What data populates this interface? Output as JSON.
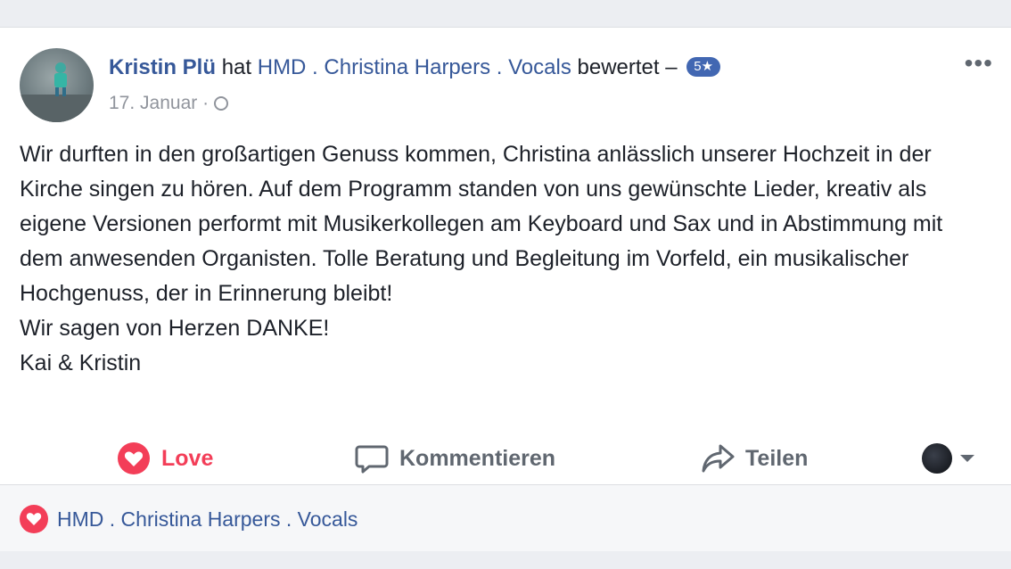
{
  "post": {
    "author": "Kristin Plü",
    "verb_has": "hat",
    "page_name": "HMD . Christina Harpers . Vocals",
    "verb_rated": "bewertet –",
    "rating_badge": "5★",
    "date": "17. Januar",
    "separator": "·",
    "paragraph_lines": [
      "Wir durften in den großartigen Genuss kommen, Christina anlässlich unserer Hochzeit in der Kirche singen zu hören. Auf dem Programm standen von uns gewünschte Lieder, kreativ als eigene Versionen performt mit Musikerkollegen am Keyboard und Sax und in Abstimmung mit dem anwesenden Organisten. Tolle Beratung und Begleitung im Vorfeld, ein musikalischer Hochgenuss, der in Erinnerung bleibt!",
      "Wir sagen von Herzen DANKE!",
      "Kai & Kristin"
    ],
    "more_label": "•••"
  },
  "actions": {
    "love": "Love",
    "comment": "Kommentieren",
    "share": "Teilen"
  },
  "footer": {
    "reactor": "HMD . Christina Harpers . Vocals"
  },
  "colors": {
    "link": "#365899",
    "love": "#f33e58",
    "badge": "#4267b2"
  }
}
